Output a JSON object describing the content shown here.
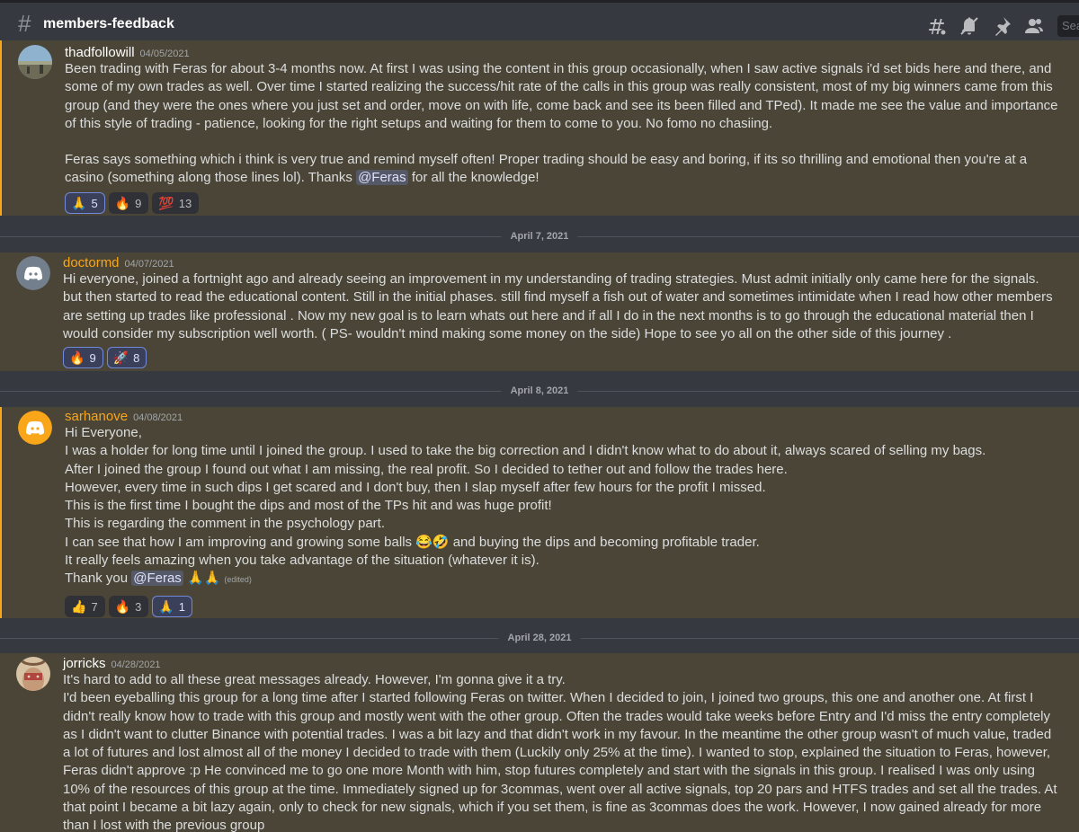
{
  "channel": {
    "name": "members-feedback",
    "search_placeholder": "Search"
  },
  "toolbar_icons": [
    "threads-icon",
    "mute-bell-icon",
    "pin-icon",
    "members-icon"
  ],
  "dividers": [
    "April 7, 2021",
    "April 8, 2021",
    "April 28, 2021"
  ],
  "messages": [
    {
      "author": "thadfollowill",
      "timestamp": "04/05/2021",
      "author_color": "#ffffff",
      "lines": [
        "Been trading with Feras for about 3-4 months now. At first I was using the content in this group occasionally, when I saw active signals i'd set bids here and there, and some of my own trades as well. Over time I started realizing the success/hit rate of the calls in this group was really consistent, most of my big winners came from this group (and they were the ones where you just set and order, move on with life, come back and see its been filled and TPed). It made me see the value and importance of this style of trading - patience, looking for the right setups and waiting for them to come to you. No fomo no chasiing.",
        "",
        "Feras says something which i think is very true and remind myself often! Proper trading should be easy and boring, if its so thrilling and emotional then you're at a casino (something along those lines lol). Thanks"
      ],
      "mention": "@Feras",
      "after_mention": " for all the knowledge!",
      "reactions": [
        {
          "emoji": "🙏",
          "count": "5",
          "me": true
        },
        {
          "emoji": "🔥",
          "count": "9",
          "me": false
        },
        {
          "emoji": "💯",
          "count": "13",
          "me": false
        }
      ]
    },
    {
      "author": "doctormd",
      "timestamp": "04/07/2021",
      "author_color": "#faa61a",
      "lines": [
        "Hi everyone, joined a fortnight ago and already seeing an improvement in my understanding of trading strategies. Must admit initially only came here for the signals. but then started to read the educational content. Still in the initial phases. still find myself a fish out of water and sometimes intimidate when I read how other members are setting up trades like professional . Now my new goal is to learn whats out here and if all I do in the next months is to go through the educational material then I would consider my subscription well worth.  ( PS- wouldn't mind making some money on the side)  Hope to see yo all on the other side of this journey ."
      ],
      "reactions": [
        {
          "emoji": "🔥",
          "count": "9",
          "me": true
        },
        {
          "emoji": "🚀",
          "count": "8",
          "me": true
        }
      ]
    },
    {
      "author": "sarhanove",
      "timestamp": "04/08/2021",
      "author_color": "#faa61a",
      "lines": [
        "Hi Everyone,",
        "I was a holder for long time until I joined the group. I used to take the big correction and I didn't know what to do about it, always scared of selling my bags.",
        "After I joined the group I found out what I am missing, the real profit. So I decided to tether out and follow the trades here.",
        "However, every time in such dips I get scared and I don't buy, then I slap myself after few hours for the profit I missed.",
        "This is the first time I bought the dips and most of the TPs hit and was huge profit!",
        "This is regarding the comment in the psychology part.",
        "I can see that how I am improving and growing some balls 😂🤣  and buying the dips and becoming profitable trader.",
        "It really feels amazing when you take advantage of the situation (whatever it is)."
      ],
      "last_prefix": "Thank you ",
      "mention": "@Feras",
      "after_mention": " 🙏🙏",
      "edited": "(edited)",
      "reactions": [
        {
          "emoji": "👍",
          "count": "7",
          "me": false
        },
        {
          "emoji": "🔥",
          "count": "3",
          "me": false
        },
        {
          "emoji": "🙏",
          "count": "1",
          "me": true
        }
      ]
    },
    {
      "author": "jorricks",
      "timestamp": "04/28/2021",
      "author_color": "#ffffff",
      "lines": [
        "It's hard to add to all these great messages already. However, I'm gonna give it a try.",
        "I'd been eyeballing this group for a long time after I started following Feras on twitter. When I decided to join, I joined two groups, this one and another one. At first I didn't really know how to trade with this group and mostly went with the other group. Often the trades would take weeks before Entry and I'd miss the entry completely as I didn't want to clutter Binance with potential trades. I was a bit lazy and that didn't work in my favour. In the meantime the other group wasn't of much value, traded a lot of futures and lost almost all of the money I decided to trade with them (Luckily only 25% at the time). I wanted to stop, explained the situation to Feras, however, Feras didn't approve :p He convinced me to go one more Month with him, stop futures completely and start with the signals in this group. I realised I was only using 10% of the resources of this group at the time. Immediately signed up for 3commas, went over all active signals, top 20 pars and HTFS trades and set all the trades. At that point I became a bit lazy again,  only to check for new signals, which if you set them, is fine as 3commas does the work. However, I now gained already for more than I lost with the previous group"
      ]
    }
  ]
}
